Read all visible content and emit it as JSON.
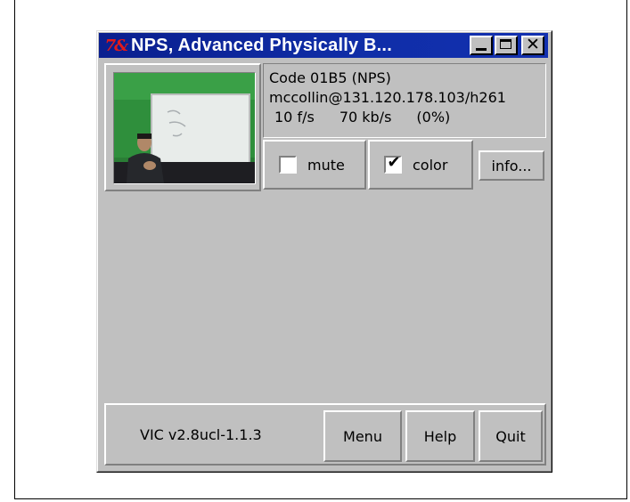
{
  "window": {
    "title": "NPS, Advanced Physically B...",
    "logo_text": "7&",
    "controls": {
      "minimize_icon": "minimize-icon",
      "maximize_icon": "maximize-icon",
      "close_icon": "close-icon",
      "close_glyph": "✕"
    }
  },
  "source": {
    "code_line": "Code 01B5 (NPS)",
    "address_line": "mccollin@131.120.178.103/h261",
    "frame_rate": "10 f/s",
    "bitrate": "70 kb/s",
    "loss": "(0%)"
  },
  "controls": {
    "mute_label": "mute",
    "mute_checked": false,
    "color_label": "color",
    "color_checked": true,
    "check_glyph": "✔",
    "info_label": "info..."
  },
  "footer": {
    "version": "VIC v2.8ucl-1.1.3",
    "menu_label": "Menu",
    "help_label": "Help",
    "quit_label": "Quit"
  },
  "colors": {
    "titlebar": "#0a1f8f",
    "window_bg": "#c0c0c0",
    "thumbnail_wall": "#2f8f3c"
  }
}
